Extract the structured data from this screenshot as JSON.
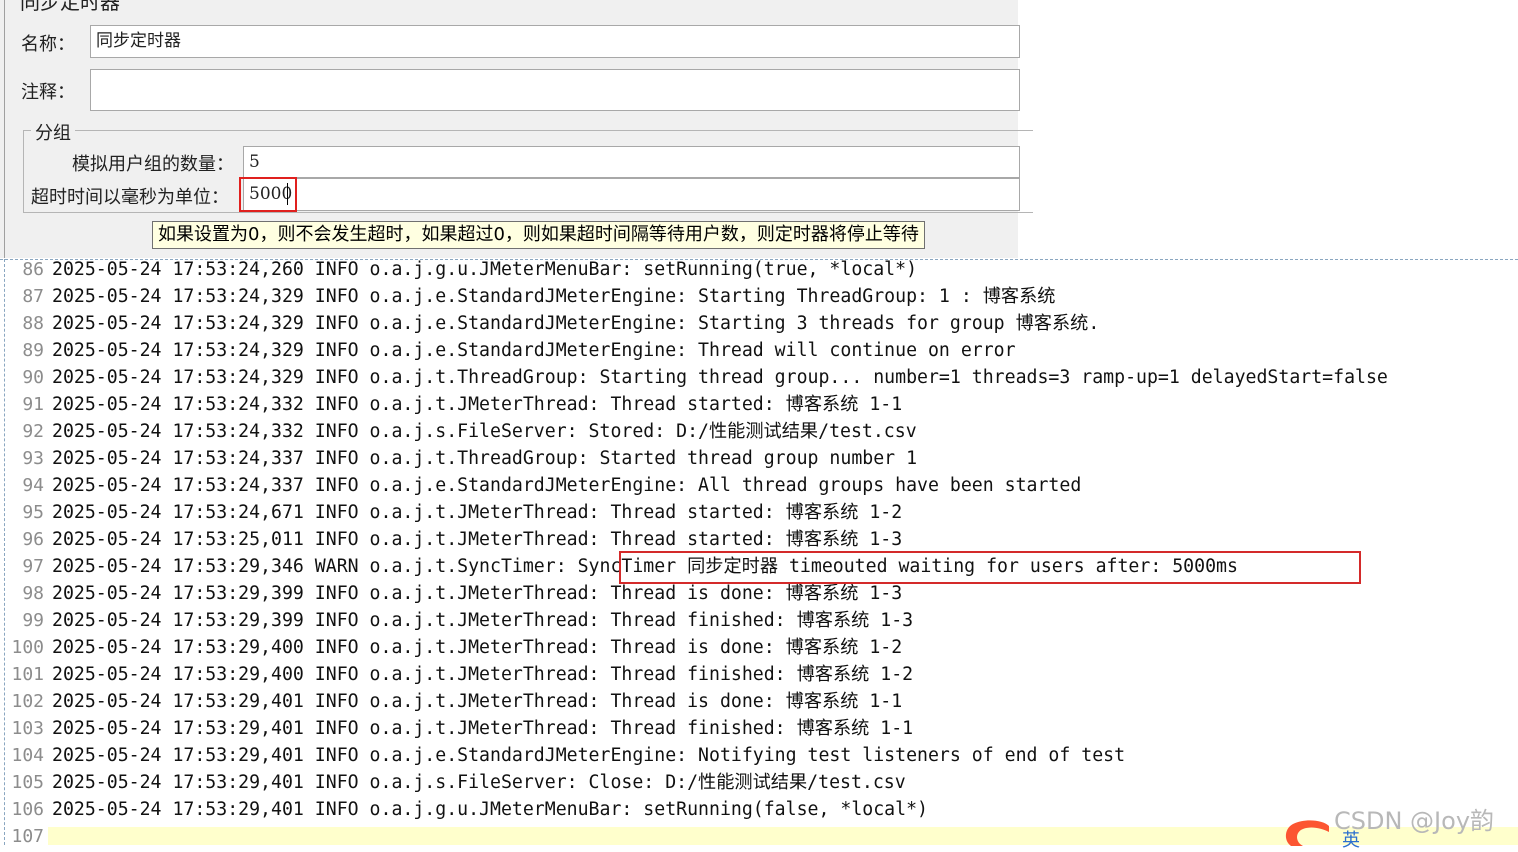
{
  "form": {
    "title": "同步定时器",
    "name_label": "名称：",
    "name_value": "同步定时器",
    "comment_label": "注释：",
    "comment_value": "",
    "group_legend": "分组",
    "users_label": "模拟用户组的数量：",
    "users_value": "5",
    "timeout_label": "超时时间以毫秒为单位：",
    "timeout_value": "5000",
    "tooltip": "如果设置为0，则不会发生超时，如果超过0，则如果超时间隔等待用户数，则定时器将停止等待"
  },
  "log": {
    "lines": [
      {
        "n": "86",
        "text": "2025-05-24 17:53:24,260 INFO o.a.j.g.u.JMeterMenuBar: setRunning(true, *local*)"
      },
      {
        "n": "87",
        "text": "2025-05-24 17:53:24,329 INFO o.a.j.e.StandardJMeterEngine: Starting ThreadGroup: 1 : 博客系统"
      },
      {
        "n": "88",
        "text": "2025-05-24 17:53:24,329 INFO o.a.j.e.StandardJMeterEngine: Starting 3 threads for group 博客系统."
      },
      {
        "n": "89",
        "text": "2025-05-24 17:53:24,329 INFO o.a.j.e.StandardJMeterEngine: Thread will continue on error"
      },
      {
        "n": "90",
        "text": "2025-05-24 17:53:24,329 INFO o.a.j.t.ThreadGroup: Starting thread group... number=1 threads=3 ramp-up=1 delayedStart=false"
      },
      {
        "n": "91",
        "text": "2025-05-24 17:53:24,332 INFO o.a.j.t.JMeterThread: Thread started: 博客系统 1-1"
      },
      {
        "n": "92",
        "text": "2025-05-24 17:53:24,332 INFO o.a.j.s.FileServer: Stored: D:/性能测试结果/test.csv"
      },
      {
        "n": "93",
        "text": "2025-05-24 17:53:24,337 INFO o.a.j.t.ThreadGroup: Started thread group number 1"
      },
      {
        "n": "94",
        "text": "2025-05-24 17:53:24,337 INFO o.a.j.e.StandardJMeterEngine: All thread groups have been started"
      },
      {
        "n": "95",
        "text": "2025-05-24 17:53:24,671 INFO o.a.j.t.JMeterThread: Thread started: 博客系统 1-2"
      },
      {
        "n": "96",
        "text": "2025-05-24 17:53:25,011 INFO o.a.j.t.JMeterThread: Thread started: 博客系统 1-3"
      },
      {
        "n": "97",
        "text": "2025-05-24 17:53:29,346 WARN o.a.j.t.SyncTimer: SyncTimer 同步定时器 timeouted waiting for users after: 5000ms"
      },
      {
        "n": "98",
        "text": "2025-05-24 17:53:29,399 INFO o.a.j.t.JMeterThread: Thread is done: 博客系统 1-3"
      },
      {
        "n": "99",
        "text": "2025-05-24 17:53:29,399 INFO o.a.j.t.JMeterThread: Thread finished: 博客系统 1-3"
      },
      {
        "n": "100",
        "text": "2025-05-24 17:53:29,400 INFO o.a.j.t.JMeterThread: Thread is done: 博客系统 1-2"
      },
      {
        "n": "101",
        "text": "2025-05-24 17:53:29,400 INFO o.a.j.t.JMeterThread: Thread finished: 博客系统 1-2"
      },
      {
        "n": "102",
        "text": "2025-05-24 17:53:29,401 INFO o.a.j.t.JMeterThread: Thread is done: 博客系统 1-1"
      },
      {
        "n": "103",
        "text": "2025-05-24 17:53:29,401 INFO o.a.j.t.JMeterThread: Thread finished: 博客系统 1-1"
      },
      {
        "n": "104",
        "text": "2025-05-24 17:53:29,401 INFO o.a.j.e.StandardJMeterEngine: Notifying test listeners of end of test"
      },
      {
        "n": "105",
        "text": "2025-05-24 17:53:29,401 INFO o.a.j.s.FileServer: Close: D:/性能测试结果/test.csv"
      },
      {
        "n": "106",
        "text": "2025-05-24 17:53:29,401 INFO o.a.j.g.u.JMeterMenuBar: setRunning(false, *local*)"
      },
      {
        "n": "107",
        "text": ""
      }
    ]
  },
  "watermark": {
    "text": "CSDN @Joy韵",
    "badge_text": "英",
    "logo_icon": "csdn-logo-icon",
    "logo_color": "#fc5531"
  }
}
